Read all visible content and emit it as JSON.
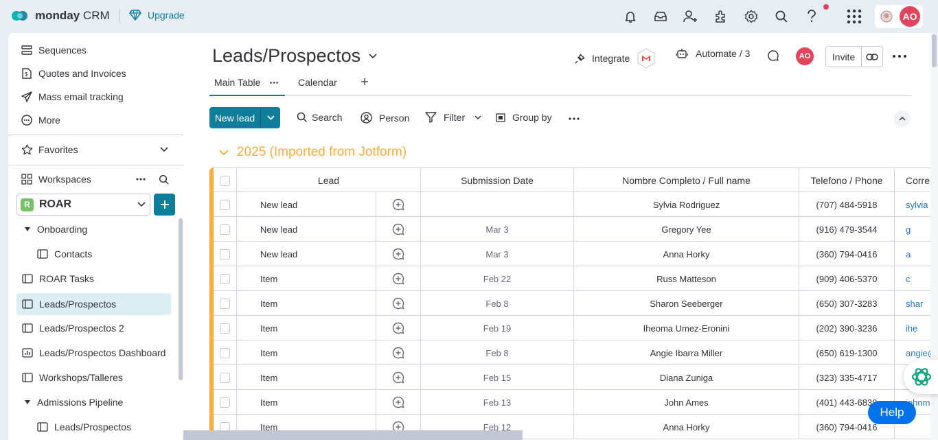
{
  "topbar": {
    "brand_bold": "monday",
    "brand_light": " CRM",
    "upgrade": "Upgrade",
    "user_initials": "AO",
    "icons": [
      "bell-icon",
      "inbox-icon",
      "invite-user-icon",
      "apps-icon",
      "settings-icon",
      "search-icon",
      "help-icon",
      "grid-menu-icon"
    ]
  },
  "sidebar": {
    "top_items": [
      {
        "label": "Sequences",
        "icon": "sequences-icon"
      },
      {
        "label": "Quotes and Invoices",
        "icon": "quotes-icon"
      },
      {
        "label": "Mass email tracking",
        "icon": "send-icon"
      },
      {
        "label": "More",
        "icon": "more-circle-icon"
      }
    ],
    "favorites": "Favorites",
    "workspaces": "Workspaces",
    "workspace_badge": "R",
    "workspace_name": "ROAR",
    "tree": [
      {
        "label": "Onboarding",
        "type": "folder"
      },
      {
        "label": "Contacts",
        "type": "board"
      },
      {
        "label": "ROAR Tasks",
        "type": "board"
      },
      {
        "label": "Leads/Prospectos",
        "type": "board",
        "active": true
      },
      {
        "label": "Leads/Prospectos 2",
        "type": "board"
      },
      {
        "label": "Leads/Prospectos Dashboard",
        "type": "dashboard"
      },
      {
        "label": "Workshops/Talleres",
        "type": "board"
      },
      {
        "label": "Admissions Pipeline",
        "type": "folder"
      },
      {
        "label": "Leads/Prospectos",
        "type": "board"
      }
    ]
  },
  "board": {
    "title": "Leads/Prospectos",
    "integrate": "Integrate",
    "automate": "Automate / 3",
    "avatar": "AO",
    "invite": "Invite",
    "tabs": [
      "Main Table",
      "Calendar"
    ],
    "new_item": "New lead",
    "toolbar": {
      "search": "Search",
      "person": "Person",
      "filter": "Filter",
      "group_by": "Group by"
    },
    "group_title": "2025 (Imported from Jotform)",
    "group_color": "#fdab3d",
    "columns": {
      "lead": "Lead",
      "date": "Submission Date",
      "name": "Nombre Completo / Full name",
      "phone": "Telefono / Phone",
      "email": "Corre"
    },
    "rows": [
      {
        "lead": "New lead",
        "date": "",
        "name": "Sylvia Rodriguez",
        "phone": "(707) 484-5918",
        "email": "sylvia"
      },
      {
        "lead": "New lead",
        "date": "Mar 3",
        "name": "Gregory Yee",
        "phone": "(916) 479-3544",
        "email": "g"
      },
      {
        "lead": "New lead",
        "date": "Mar 3",
        "name": "Anna Horky",
        "phone": "(360) 794-0416",
        "email": "a"
      },
      {
        "lead": "Item",
        "date": "Feb 22",
        "name": "Russ Matteson",
        "phone": "(909) 406-5370",
        "email": "c"
      },
      {
        "lead": "Item",
        "date": "Feb 8",
        "name": "Sharon Seeberger",
        "phone": "(650) 307-3283",
        "email": "shar"
      },
      {
        "lead": "Item",
        "date": "Feb 19",
        "name": "Iheoma Umez-Eronini",
        "phone": "(202) 390-3236",
        "email": "ihe"
      },
      {
        "lead": "Item",
        "date": "Feb 8",
        "name": "Angie Ibarra Miller",
        "phone": "(650) 619-1300",
        "email": "angie@"
      },
      {
        "lead": "Item",
        "date": "Feb 15",
        "name": "Diana Zuniga",
        "phone": "(323) 335-4717",
        "email": ""
      },
      {
        "lead": "Item",
        "date": "Feb 13",
        "name": "John Ames",
        "phone": "(401) 443-6839",
        "email": "johnmi"
      },
      {
        "lead": "Item",
        "date": "Feb 12",
        "name": "Anna Horky",
        "phone": "(360) 794-0416",
        "email": ""
      }
    ]
  },
  "help": "Help",
  "colors": {
    "accent": "#0f7e9b",
    "avatar": "#e2445c",
    "help": "#0073ea"
  }
}
